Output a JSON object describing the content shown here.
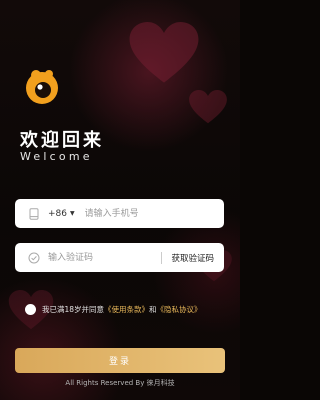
{
  "header": {
    "title_cn": "欢迎回来",
    "title_en": "Welcome"
  },
  "phone_field": {
    "country_code": "+86",
    "placeholder": "请输入手机号",
    "value": ""
  },
  "code_field": {
    "placeholder": "输入验证码",
    "value": "",
    "get_code_label": "获取验证码"
  },
  "agreement": {
    "prefix": "我已满18岁并同意",
    "terms_link": "《使用条款》",
    "and": "和",
    "privacy_link": "《隐私协议》",
    "checked": false
  },
  "login_button": {
    "label": "登录"
  },
  "footer": {
    "text": "All Rights Reserved By 徕月科技"
  },
  "colors": {
    "accent": "#e8b85a",
    "button_start": "#d9a85a",
    "button_end": "#e9c27a",
    "logo_orange": "#f2a01e"
  },
  "icons": {
    "logo": "app-logo",
    "phone": "phone-icon",
    "code": "shield-check-icon",
    "caret": "caret-down-icon"
  }
}
